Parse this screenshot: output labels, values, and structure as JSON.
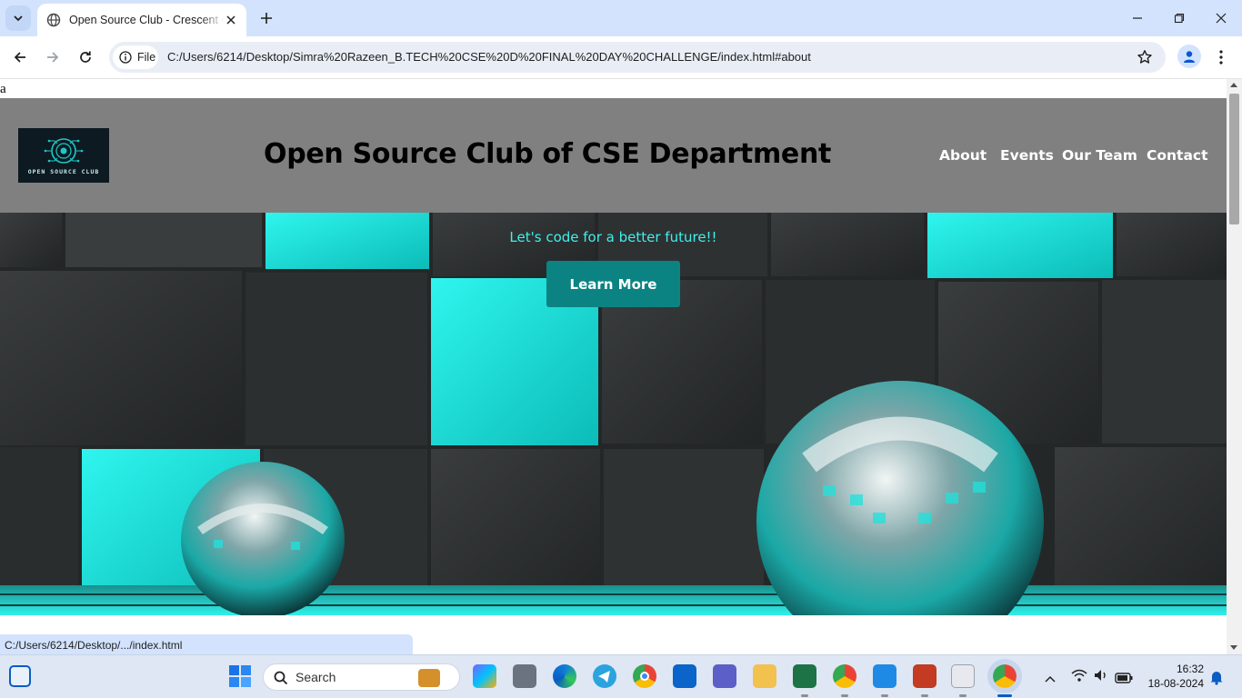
{
  "browser": {
    "tab_title": "Open Source Club - Crescent C",
    "scheme_chip": "File",
    "url": "C:/Users/6214/Desktop/Simra%20Razeen_B.TECH%20CSE%20D%20FINAL%20DAY%20CHALLENGE/index.html#about",
    "status_url": "C:/Users/6214/Desktop/.../index.html"
  },
  "page": {
    "stray_text": "a",
    "logo_text": "OPEN SOURCE CLUB",
    "title": "Open Source Club of CSE Department",
    "nav": [
      "About",
      "Events",
      "Our Team",
      "Contact"
    ],
    "tagline": "Let's code for a better future!!",
    "cta_label": "Learn More"
  },
  "taskbar": {
    "search_label": "Search",
    "time": "16:32",
    "date": "18-08-2024"
  },
  "colors": {
    "header_bg": "#808080",
    "accent_teal": "#0c8383",
    "tagline": "#3ff0ec"
  }
}
